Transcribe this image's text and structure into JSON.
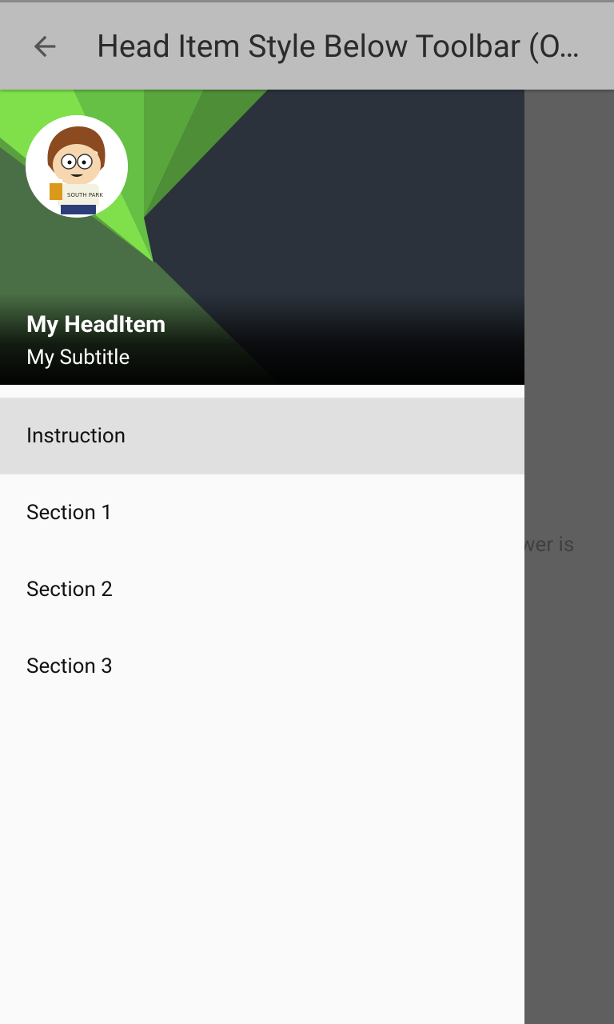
{
  "toolbar": {
    "title": "Head Item Style Below Toolbar (O…",
    "back_icon": "arrow-back-icon",
    "background": "#bdbdbd"
  },
  "background_content": {
    "peek_text": "answer is"
  },
  "drawer": {
    "header": {
      "title": "My HeadItem",
      "subtitle": "My Subtitle",
      "avatar_icon": "profile-avatar-icon"
    },
    "items": [
      {
        "label": "Instruction",
        "selected": true
      },
      {
        "label": "Section 1",
        "selected": false
      },
      {
        "label": "Section 2",
        "selected": false
      },
      {
        "label": "Section 3",
        "selected": false
      }
    ],
    "selected_color": "#e0e0e0",
    "background": "#fafafa"
  }
}
